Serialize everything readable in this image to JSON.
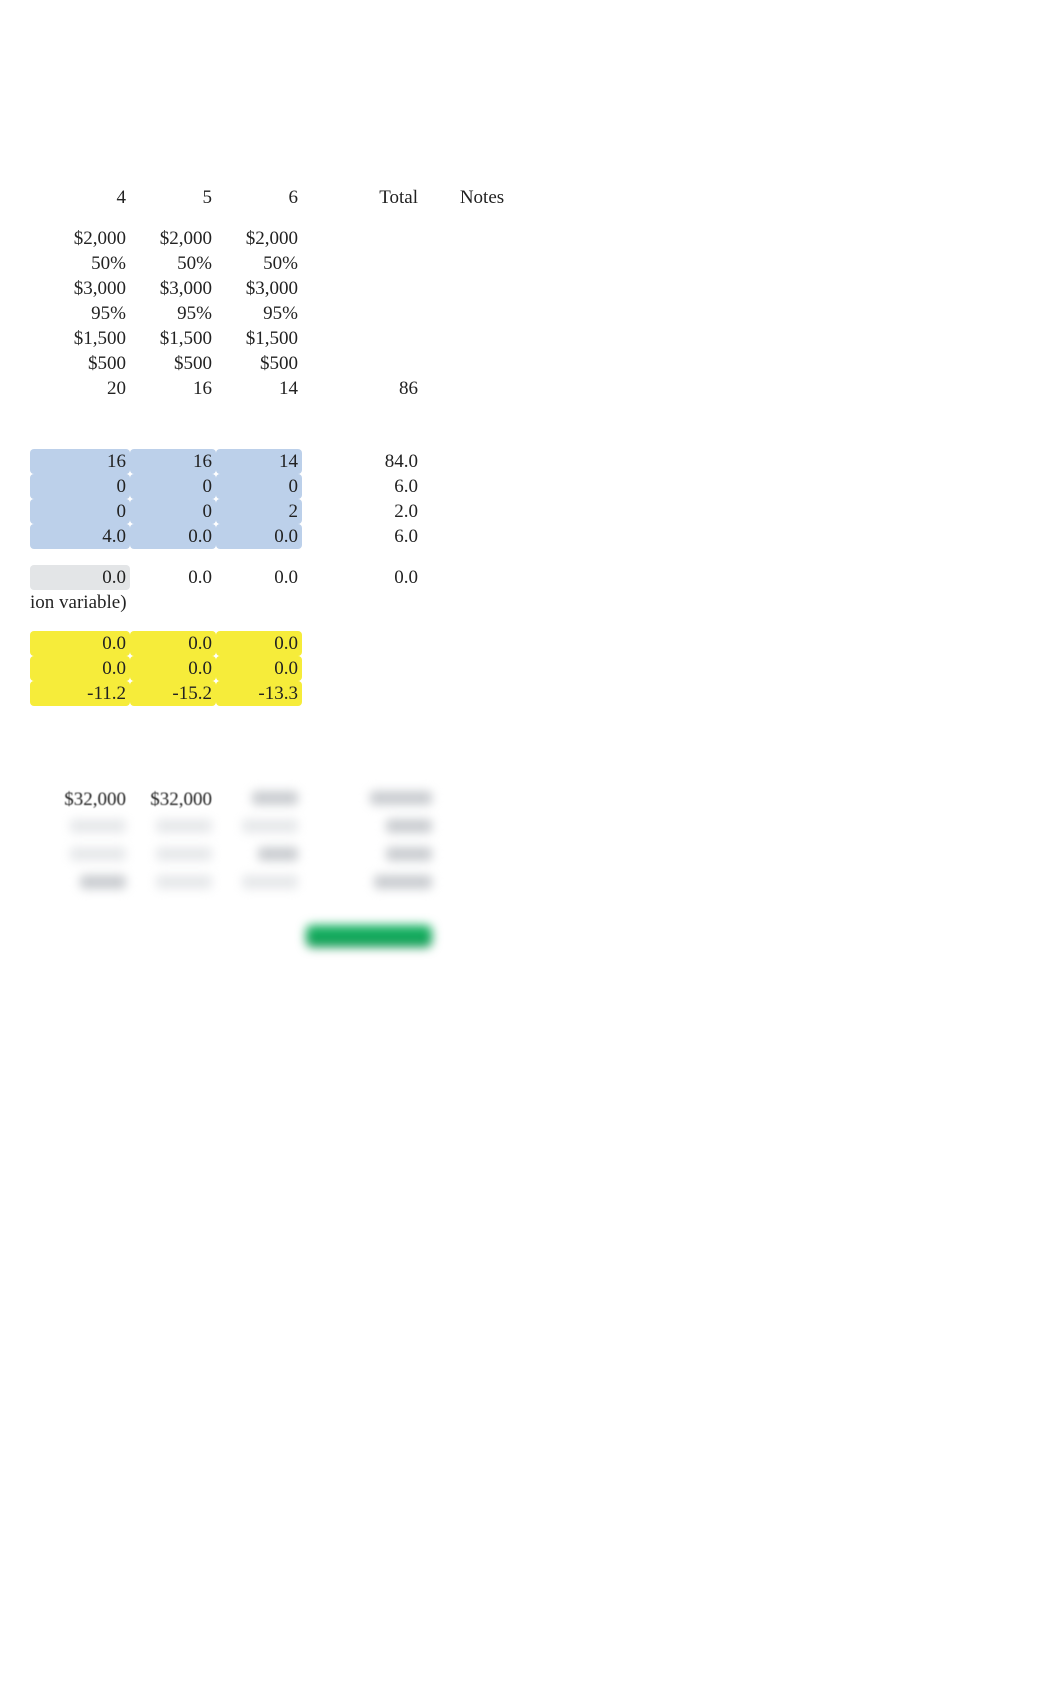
{
  "headers": {
    "c4": "4",
    "c5": "5",
    "c6": "6",
    "total": "Total",
    "notes": "Notes"
  },
  "rows": {
    "a": {
      "c4": "$2,000",
      "c5": "$2,000",
      "c6": "$2,000"
    },
    "b": {
      "c4": "50%",
      "c5": "50%",
      "c6": "50%"
    },
    "c": {
      "c4": "$3,000",
      "c5": "$3,000",
      "c6": "$3,000"
    },
    "d": {
      "c4": "95%",
      "c5": "95%",
      "c6": "95%"
    },
    "e": {
      "c4": "$1,500",
      "c5": "$1,500",
      "c6": "$1,500"
    },
    "f": {
      "c4": "$500",
      "c5": "$500",
      "c6": "$500"
    },
    "g": {
      "c4": "20",
      "c5": "16",
      "c6": "14",
      "total": "86"
    }
  },
  "blue": {
    "r1": {
      "c4": "16",
      "c5": "16",
      "c6": "14",
      "total": "84.0"
    },
    "r2": {
      "c4": "0",
      "c5": "0",
      "c6": "0",
      "total": "6.0"
    },
    "r3": {
      "c4": "0",
      "c5": "0",
      "c6": "2",
      "total": "2.0"
    },
    "r4": {
      "c4": "4.0",
      "c5": "0.0",
      "c6": "0.0",
      "total": "6.0"
    }
  },
  "grey": {
    "r1": {
      "c4": "0.0",
      "c5": "0.0",
      "c6": "0.0",
      "total": "0.0"
    }
  },
  "label": {
    "text": "ion variable)"
  },
  "yellow": {
    "r1": {
      "c4": "0.0",
      "c5": "0.0",
      "c6": "0.0"
    },
    "r2": {
      "c4": "0.0",
      "c5": "0.0",
      "c6": "0.0"
    },
    "r3": {
      "c4": "-11.2",
      "c5": "-15.2",
      "c6": "-13.3"
    }
  },
  "lower": {
    "r1": {
      "c4": "$32,000",
      "c5": "$32,000"
    }
  }
}
